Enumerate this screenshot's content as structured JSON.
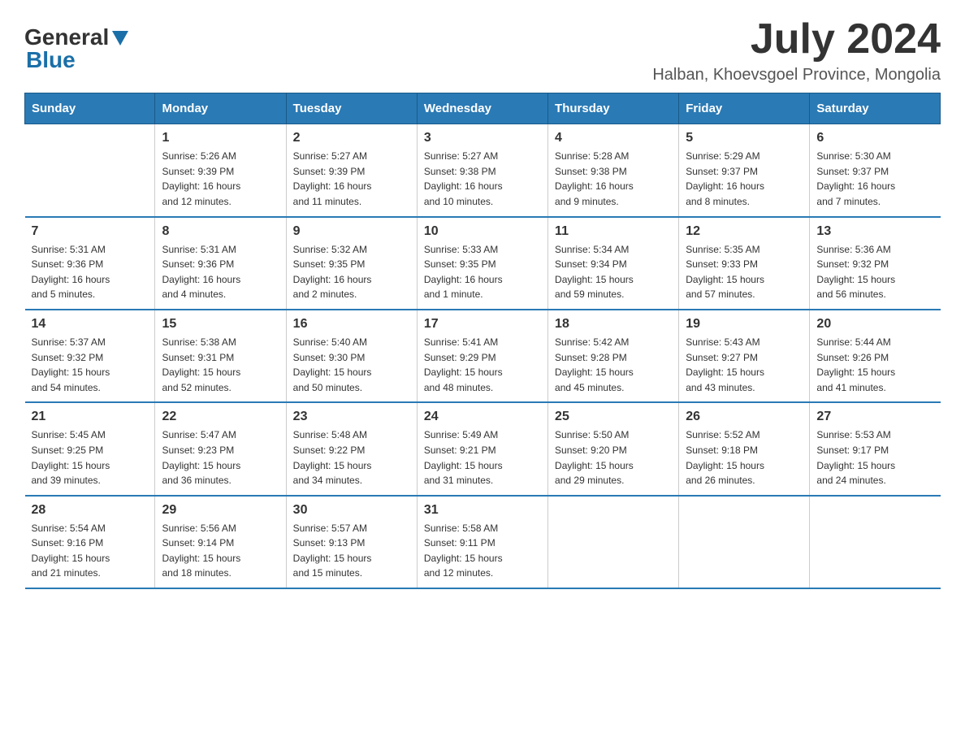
{
  "logo": {
    "general": "General",
    "blue": "Blue"
  },
  "title": "July 2024",
  "location": "Halban, Khoevsgoel Province, Mongolia",
  "header_days": [
    "Sunday",
    "Monday",
    "Tuesday",
    "Wednesday",
    "Thursday",
    "Friday",
    "Saturday"
  ],
  "weeks": [
    [
      {
        "day": "",
        "info": ""
      },
      {
        "day": "1",
        "info": "Sunrise: 5:26 AM\nSunset: 9:39 PM\nDaylight: 16 hours\nand 12 minutes."
      },
      {
        "day": "2",
        "info": "Sunrise: 5:27 AM\nSunset: 9:39 PM\nDaylight: 16 hours\nand 11 minutes."
      },
      {
        "day": "3",
        "info": "Sunrise: 5:27 AM\nSunset: 9:38 PM\nDaylight: 16 hours\nand 10 minutes."
      },
      {
        "day": "4",
        "info": "Sunrise: 5:28 AM\nSunset: 9:38 PM\nDaylight: 16 hours\nand 9 minutes."
      },
      {
        "day": "5",
        "info": "Sunrise: 5:29 AM\nSunset: 9:37 PM\nDaylight: 16 hours\nand 8 minutes."
      },
      {
        "day": "6",
        "info": "Sunrise: 5:30 AM\nSunset: 9:37 PM\nDaylight: 16 hours\nand 7 minutes."
      }
    ],
    [
      {
        "day": "7",
        "info": "Sunrise: 5:31 AM\nSunset: 9:36 PM\nDaylight: 16 hours\nand 5 minutes."
      },
      {
        "day": "8",
        "info": "Sunrise: 5:31 AM\nSunset: 9:36 PM\nDaylight: 16 hours\nand 4 minutes."
      },
      {
        "day": "9",
        "info": "Sunrise: 5:32 AM\nSunset: 9:35 PM\nDaylight: 16 hours\nand 2 minutes."
      },
      {
        "day": "10",
        "info": "Sunrise: 5:33 AM\nSunset: 9:35 PM\nDaylight: 16 hours\nand 1 minute."
      },
      {
        "day": "11",
        "info": "Sunrise: 5:34 AM\nSunset: 9:34 PM\nDaylight: 15 hours\nand 59 minutes."
      },
      {
        "day": "12",
        "info": "Sunrise: 5:35 AM\nSunset: 9:33 PM\nDaylight: 15 hours\nand 57 minutes."
      },
      {
        "day": "13",
        "info": "Sunrise: 5:36 AM\nSunset: 9:32 PM\nDaylight: 15 hours\nand 56 minutes."
      }
    ],
    [
      {
        "day": "14",
        "info": "Sunrise: 5:37 AM\nSunset: 9:32 PM\nDaylight: 15 hours\nand 54 minutes."
      },
      {
        "day": "15",
        "info": "Sunrise: 5:38 AM\nSunset: 9:31 PM\nDaylight: 15 hours\nand 52 minutes."
      },
      {
        "day": "16",
        "info": "Sunrise: 5:40 AM\nSunset: 9:30 PM\nDaylight: 15 hours\nand 50 minutes."
      },
      {
        "day": "17",
        "info": "Sunrise: 5:41 AM\nSunset: 9:29 PM\nDaylight: 15 hours\nand 48 minutes."
      },
      {
        "day": "18",
        "info": "Sunrise: 5:42 AM\nSunset: 9:28 PM\nDaylight: 15 hours\nand 45 minutes."
      },
      {
        "day": "19",
        "info": "Sunrise: 5:43 AM\nSunset: 9:27 PM\nDaylight: 15 hours\nand 43 minutes."
      },
      {
        "day": "20",
        "info": "Sunrise: 5:44 AM\nSunset: 9:26 PM\nDaylight: 15 hours\nand 41 minutes."
      }
    ],
    [
      {
        "day": "21",
        "info": "Sunrise: 5:45 AM\nSunset: 9:25 PM\nDaylight: 15 hours\nand 39 minutes."
      },
      {
        "day": "22",
        "info": "Sunrise: 5:47 AM\nSunset: 9:23 PM\nDaylight: 15 hours\nand 36 minutes."
      },
      {
        "day": "23",
        "info": "Sunrise: 5:48 AM\nSunset: 9:22 PM\nDaylight: 15 hours\nand 34 minutes."
      },
      {
        "day": "24",
        "info": "Sunrise: 5:49 AM\nSunset: 9:21 PM\nDaylight: 15 hours\nand 31 minutes."
      },
      {
        "day": "25",
        "info": "Sunrise: 5:50 AM\nSunset: 9:20 PM\nDaylight: 15 hours\nand 29 minutes."
      },
      {
        "day": "26",
        "info": "Sunrise: 5:52 AM\nSunset: 9:18 PM\nDaylight: 15 hours\nand 26 minutes."
      },
      {
        "day": "27",
        "info": "Sunrise: 5:53 AM\nSunset: 9:17 PM\nDaylight: 15 hours\nand 24 minutes."
      }
    ],
    [
      {
        "day": "28",
        "info": "Sunrise: 5:54 AM\nSunset: 9:16 PM\nDaylight: 15 hours\nand 21 minutes."
      },
      {
        "day": "29",
        "info": "Sunrise: 5:56 AM\nSunset: 9:14 PM\nDaylight: 15 hours\nand 18 minutes."
      },
      {
        "day": "30",
        "info": "Sunrise: 5:57 AM\nSunset: 9:13 PM\nDaylight: 15 hours\nand 15 minutes."
      },
      {
        "day": "31",
        "info": "Sunrise: 5:58 AM\nSunset: 9:11 PM\nDaylight: 15 hours\nand 12 minutes."
      },
      {
        "day": "",
        "info": ""
      },
      {
        "day": "",
        "info": ""
      },
      {
        "day": "",
        "info": ""
      }
    ]
  ]
}
